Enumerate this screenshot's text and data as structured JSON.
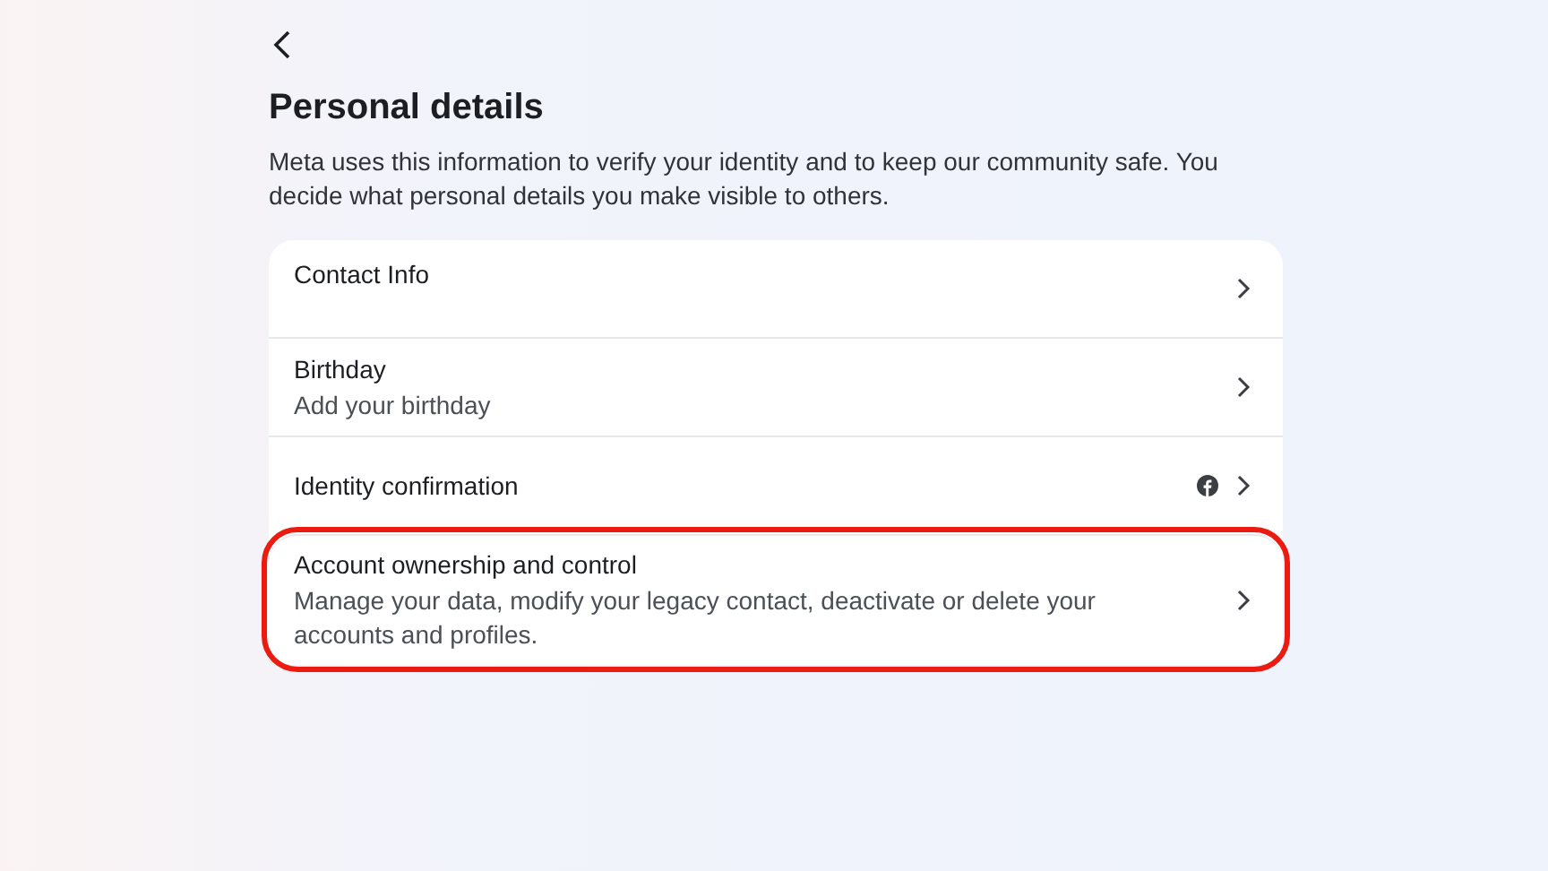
{
  "title": "Personal details",
  "description": "Meta uses this information to verify your identity and to keep our community safe. You decide what personal details you make visible to others.",
  "items": [
    {
      "kind": "plain",
      "label": "Contact Info",
      "highlighted": false
    },
    {
      "kind": "plain",
      "label": "Birthday",
      "subtitle": "Add your birthday",
      "highlighted": false
    },
    {
      "kind": "with-icon",
      "label": "Identity confirmation",
      "highlighted": false
    },
    {
      "kind": "plain",
      "label": "Account ownership and control",
      "subtitle": "Manage your data, modify your legacy contact, deactivate or delete your accounts and profiles.",
      "highlighted": true
    }
  ]
}
